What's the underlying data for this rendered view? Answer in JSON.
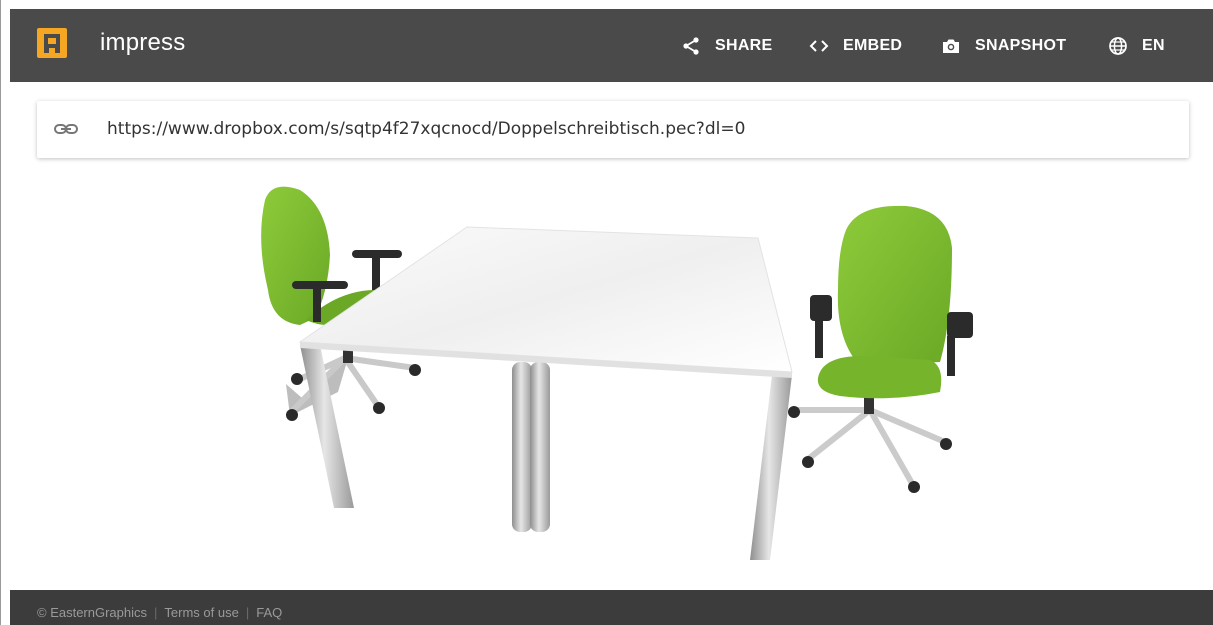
{
  "app": {
    "title": "impress"
  },
  "nav": {
    "share": "SHARE",
    "embed": "EMBED",
    "snapshot": "SNAPSHOT",
    "language": "EN"
  },
  "url_bar": {
    "value": "https://www.dropbox.com/s/sqtp4f27xqcnocd/Doppelschreibtisch.pec?dl=0"
  },
  "footer": {
    "copyright": "© EasternGraphics",
    "terms": "Terms of use",
    "faq": "FAQ"
  },
  "colors": {
    "header_bg": "#4a4a4a",
    "logo_accent": "#f5a623",
    "chair_green": "#7cb82f",
    "footer_bg": "#3c3c3c"
  }
}
